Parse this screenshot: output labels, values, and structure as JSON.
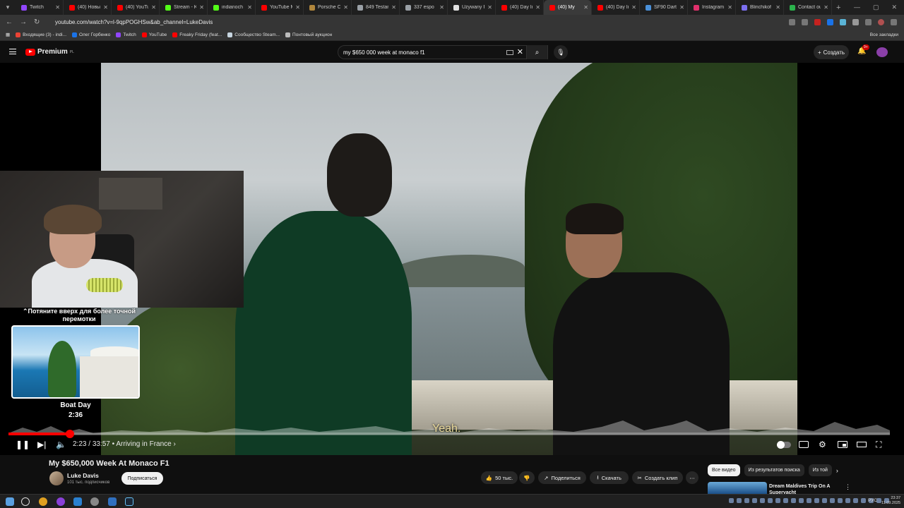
{
  "browser": {
    "tabs": [
      {
        "title": "Twitch",
        "color": "#9146ff"
      },
      {
        "title": "(40) Новый",
        "color": "#ff0000"
      },
      {
        "title": "(40) YouTub",
        "color": "#ff0000"
      },
      {
        "title": "Stream - Ki",
        "color": "#53fc18"
      },
      {
        "title": "indianoch",
        "color": "#53fc18"
      },
      {
        "title": "YouTube M",
        "color": "#ff0000"
      },
      {
        "title": "Porsche Ca",
        "color": "#b0863c"
      },
      {
        "title": "849 Testaro",
        "color": "#9aa0a6"
      },
      {
        "title": "337 espo",
        "color": "#9aa0a6"
      },
      {
        "title": "Używany Fe",
        "color": "#e0e0e0"
      },
      {
        "title": "(40) Day In",
        "color": "#ff0000"
      },
      {
        "title": "(40) My",
        "color": "#ff0000"
      },
      {
        "title": "(40) Day In",
        "color": "#ff0000"
      },
      {
        "title": "SF90 Darth",
        "color": "#4a90d9"
      },
      {
        "title": "Instagram",
        "color": "#e1306c"
      },
      {
        "title": "Blinchikof",
        "color": "#7c6ff0"
      },
      {
        "title": "Contact ou",
        "color": "#2bb24c"
      }
    ],
    "active_tab_index": 11,
    "url": "youtube.com/watch?v=l-9qpPOGHSw&ab_channel=LukeDavis",
    "bookmarks": [
      {
        "label": "Входящие (3) - indi...",
        "color": "#ea4335"
      },
      {
        "label": "Олег Горбенко",
        "color": "#1a73e8"
      },
      {
        "label": "Twitch",
        "color": "#9146ff"
      },
      {
        "label": "YouTube",
        "color": "#ff0000"
      },
      {
        "label": "Freaky Friday (feat...",
        "color": "#ff0000"
      },
      {
        "label": "Сообщество Steam...",
        "color": "#c7d5e0"
      },
      {
        "label": "Понтовый аукцион",
        "color": "#bbbbbb"
      }
    ],
    "all_bookmarks": "Все закладки"
  },
  "youtube": {
    "logo_text": "Premium",
    "logo_sup": "PL",
    "search_query": "my $650 000 week at monaco f1",
    "create_label": "Создать",
    "notif_count": "9+"
  },
  "player": {
    "seek_hint": "⌃Потяните вверх для более точной перемотки",
    "chapter_title": "Boat Day",
    "chapter_time": "2:36",
    "subtitle": "Yeah.",
    "current_time": "2:23",
    "duration": "33:57",
    "chapter_current": "Arriving in France",
    "progress_fraction": 0.07,
    "accent": "#ff0000"
  },
  "video": {
    "title": "My $650,000 Week At Monaco F1",
    "channel": "Luke Davis",
    "subscribers": "101 тыс. подписчиков",
    "subscribe_label": "Подписаться",
    "likes": "50 тыс.",
    "share_label": "Поделиться",
    "download_label": "Скачать",
    "clip_label": "Создать клип",
    "chips": [
      "Все видео",
      "Из результатов поиска",
      "Из той"
    ],
    "rec_title": "Dream Maldives Trip On A Superyacht"
  },
  "taskbar": {
    "lang": "РУС",
    "time": "23:37",
    "date": "11.09.2025"
  }
}
